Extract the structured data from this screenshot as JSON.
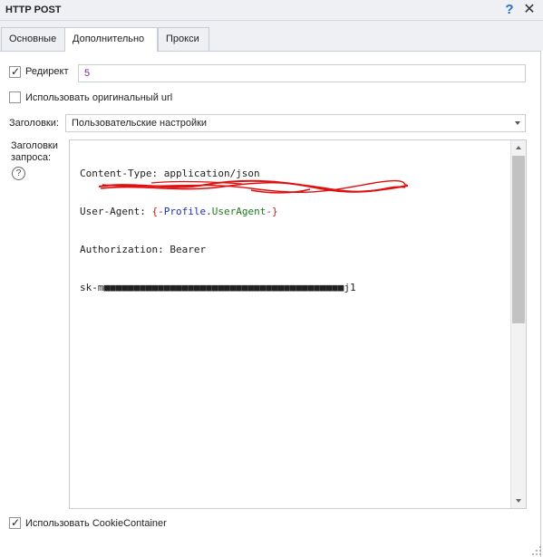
{
  "window": {
    "title": "HTTP POST",
    "help_glyph": "?",
    "close_glyph": "✕"
  },
  "tabs": [
    {
      "label": "Основные",
      "active": false
    },
    {
      "label": "Дополнительно",
      "active": true
    },
    {
      "label": "Прокси",
      "active": false
    }
  ],
  "redirect": {
    "label": "Редирект",
    "checked": true,
    "value": "5"
  },
  "original_url": {
    "label": "Использовать оригинальный url",
    "checked": false
  },
  "headers_mode": {
    "label": "Заголовки:",
    "selected": "Пользовательские настройки"
  },
  "request_headers": {
    "label_line1": "Заголовки",
    "label_line2": "запроса:",
    "lines": [
      "Content-Type: application/json",
      "User-Agent: {-Profile.UserAgent-}",
      "Authorization: Bearer",
      "sk-m■■■■■■■■■■■■■■■■■■■■■■■■■■■■■■■■■■■■■■■■j1"
    ],
    "ua_prefix": "User-Agent: ",
    "ua_tokens": [
      "{-",
      "Profile",
      ".",
      "UserAgent",
      "-}"
    ],
    "redacted": true
  },
  "cookie_container": {
    "label": "Использовать CookieContainer",
    "checked": true
  },
  "colors": {
    "accent_help": "#1e6fd0",
    "value_purple": "#7a2aa0",
    "macro_brace": "#c31a1a",
    "macro_profile": "#1b2fb8",
    "macro_prop": "#1f7a1f",
    "redaction": "#e01010"
  },
  "icons": {
    "help": "help-circle-icon",
    "check": "checkmark-icon",
    "dropdown": "chevron-down-icon"
  }
}
